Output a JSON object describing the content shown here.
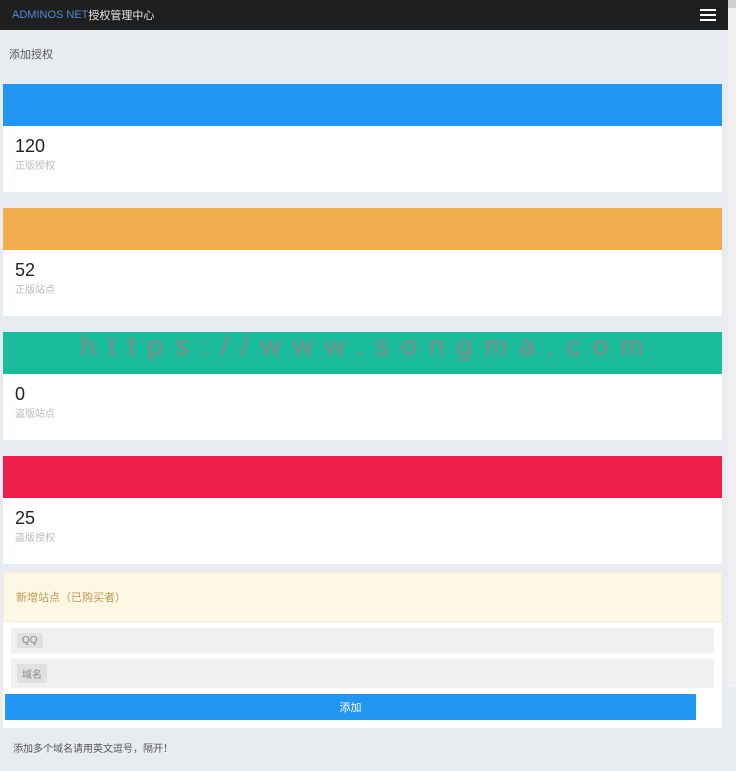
{
  "header": {
    "brand": "ADMINOS NET",
    "subtitle": "授权管理中心"
  },
  "page": {
    "title": "添加授权"
  },
  "stats": [
    {
      "value": "120",
      "label": "正版授权",
      "color": "blue"
    },
    {
      "value": "52",
      "label": "正版站点",
      "color": "orange"
    },
    {
      "value": "0",
      "label": "盗版站点",
      "color": "teal"
    },
    {
      "value": "25",
      "label": "盗版授权",
      "color": "red"
    }
  ],
  "form": {
    "title": "新增站点（已购买者）",
    "fields": {
      "qq_label": "QQ",
      "domain_label": "域名"
    },
    "submit_label": "添加",
    "note": "添加多个域名请用英文逗号，隔开！"
  },
  "watermark": "https://www.songma.com"
}
